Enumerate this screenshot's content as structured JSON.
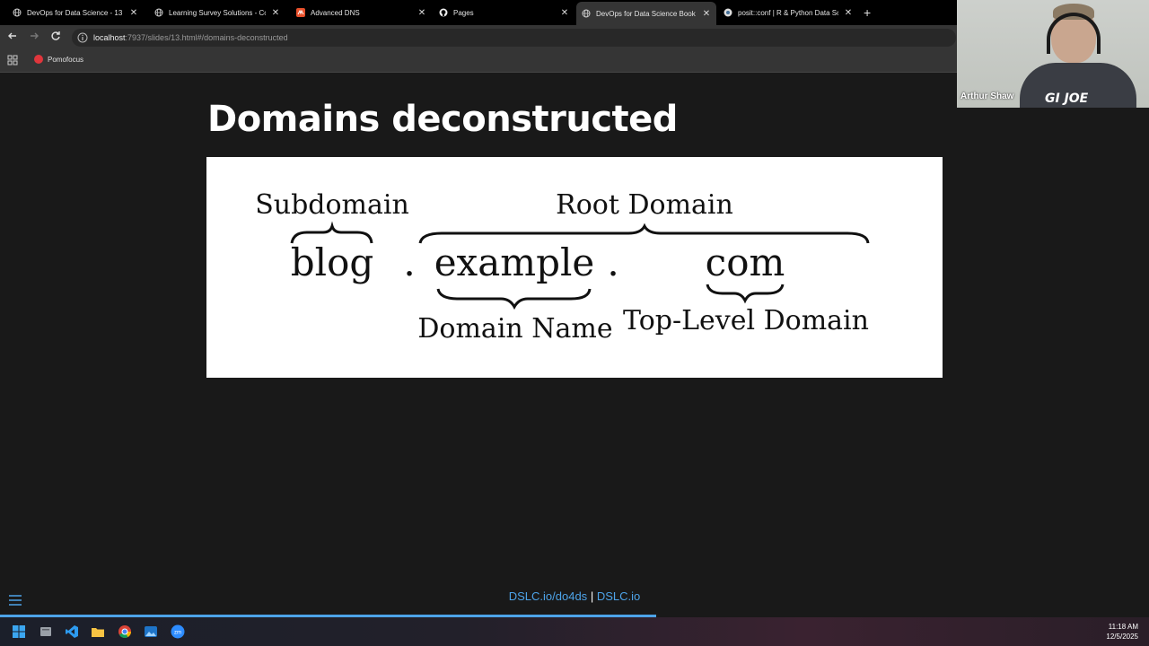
{
  "browser": {
    "tabs": [
      {
        "title": "DevOps for Data Science - 13",
        "icon": "globe-icon",
        "active": false
      },
      {
        "title": "Learning Survey Solutions - Co",
        "icon": "globe-icon",
        "active": false
      },
      {
        "title": "Advanced DNS",
        "icon": "namecheap-icon",
        "active": false
      },
      {
        "title": "Pages",
        "icon": "github-icon",
        "active": false
      },
      {
        "title": "DevOps for Data Science Book",
        "icon": "globe-icon",
        "active": true
      },
      {
        "title": "posit::conf | R & Python Data Sc",
        "icon": "posit-icon",
        "active": false
      }
    ],
    "close_glyph": "✕",
    "new_tab_glyph": "+",
    "url_host": "localhost",
    "url_path": ":7937/slides/13.html#/domains-deconstructed",
    "bookmark": "Pomofocus"
  },
  "webcam": {
    "name": "Arthur Shaw",
    "shirt_text": "GI JOE"
  },
  "slide": {
    "title": "Domains deconstructed",
    "diagram": {
      "subdomain_label": "Subdomain",
      "root_domain_label": "Root Domain",
      "part_sub": "blog",
      "dot1": ".",
      "part_domain": "example",
      "dot2": ".",
      "part_tld": "com",
      "domain_name_label": "Domain Name",
      "tld_label": "Top-Level Domain"
    },
    "footer": {
      "link1": "DSLC.io/do4ds",
      "separator": "|",
      "link2": "DSLC.io"
    },
    "progress": 0.571
  },
  "taskbar": {
    "apps": [
      "windows-start-icon",
      "file-explorer-icon",
      "vscode-icon",
      "folder-icon",
      "chrome-icon",
      "photos-icon",
      "zoom-icon"
    ],
    "time": "11:18 AM",
    "date": "12/5/2025"
  },
  "colors": {
    "accent": "#4da3e8",
    "background": "#191919"
  }
}
